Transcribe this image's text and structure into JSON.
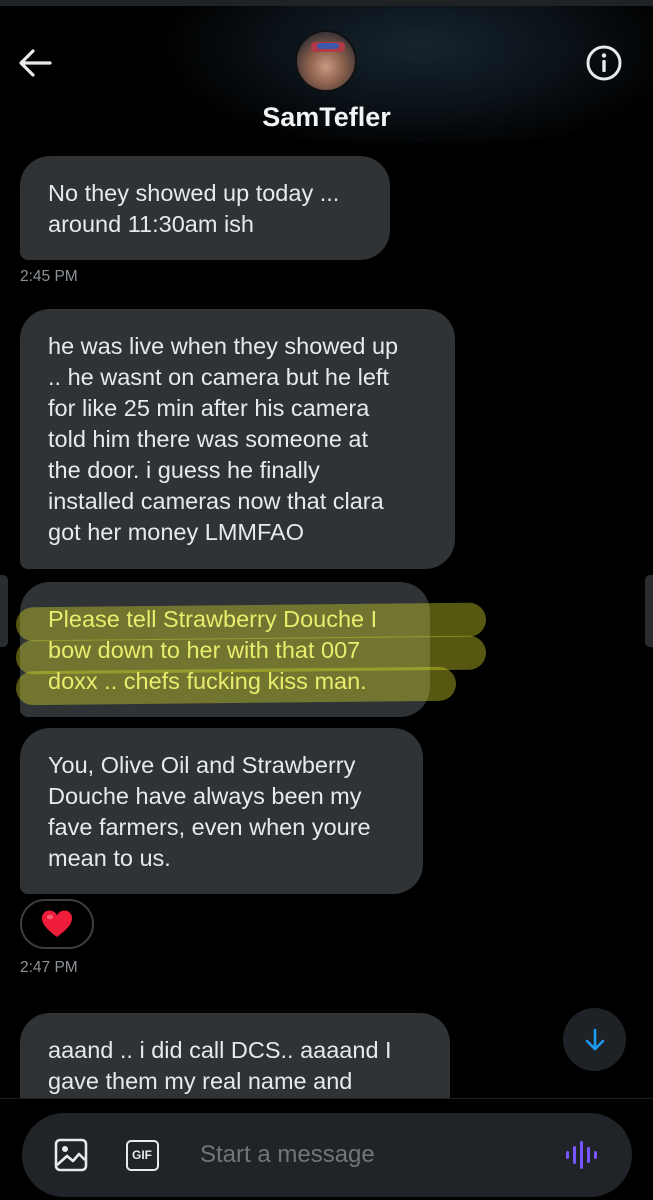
{
  "header": {
    "contact_name": "SamTefler",
    "back_icon": "arrow-left-icon",
    "info_icon": "info-circle-icon"
  },
  "messages": [
    {
      "text": "No they showed up today ...\naround 11:30am ish"
    },
    {
      "text": "he was live when they showed up\n.. he wasnt on camera but he left\nfor like 25 min after his camera\ntold him there was someone at\nthe door. i guess he finally\ninstalled cameras now that clara\ngot her money LMMFAO"
    },
    {
      "text": "Please tell Strawberry Douche I\nbow down to her with that 007\ndoxx .. chefs fucking kiss man."
    },
    {
      "text": "You, Olive Oil and Strawberry\nDouche have always been my\nfave farmers, even when youre\nmean to us."
    },
    {
      "text": "aaand .. i did call DCS.. aaaand I\ngave them my real name and"
    }
  ],
  "timestamps": [
    "2:45 PM",
    "2:47 PM"
  ],
  "reaction": {
    "emoji": "❤️"
  },
  "composer": {
    "placeholder": "Start a message",
    "gif_label": "GIF"
  },
  "colors": {
    "bubble": "#2f3336",
    "highlight_text": "#e9ed6d",
    "accent_blue": "#1d9bf0",
    "voice_purple": "#7856ff"
  }
}
